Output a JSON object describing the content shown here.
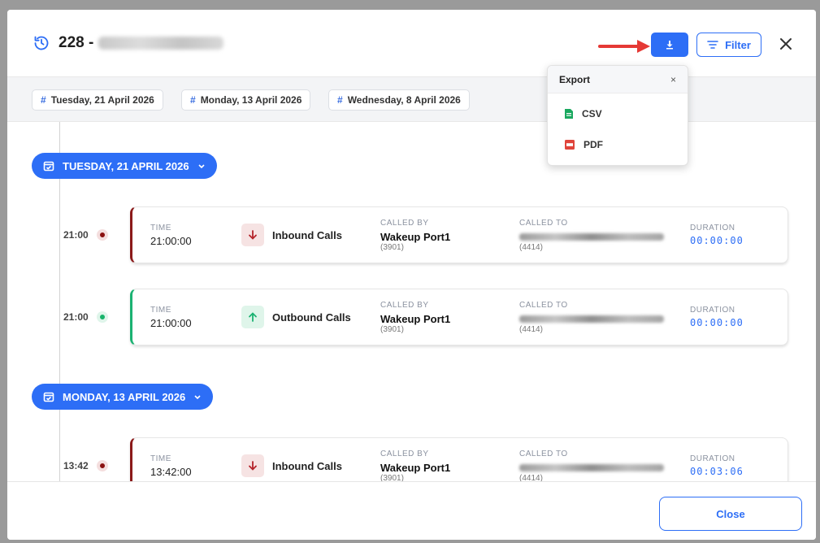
{
  "header": {
    "title_prefix": "228 -",
    "filter_label": "Filter"
  },
  "export_menu": {
    "title": "Export",
    "close": "×",
    "items": [
      {
        "label": "CSV",
        "icon": "csv-file-icon",
        "color": "#1aa85f"
      },
      {
        "label": "PDF",
        "icon": "pdf-file-icon",
        "color": "#e0443a"
      }
    ]
  },
  "date_chips": [
    {
      "hash": "#",
      "label": "Tuesday, 21 April 2026"
    },
    {
      "hash": "#",
      "label": "Monday, 13 April 2026"
    },
    {
      "hash": "#",
      "label": "Wednesday, 8 April 2026"
    }
  ],
  "groups": [
    {
      "date_label": "TUESDAY, 21 APRIL 2026",
      "calls": [
        {
          "time_short": "21:00",
          "time_label": "TIME",
          "time": "21:00:00",
          "type": "Inbound Calls",
          "called_by_label": "CALLED BY",
          "called_by": "Wakeup Port1",
          "called_by_ext": "(3901)",
          "called_to_label": "CALLED TO",
          "called_to_ext": "(4414)",
          "duration_label": "DURATION",
          "duration": "00:00:00"
        },
        {
          "time_short": "21:00",
          "time_label": "TIME",
          "time": "21:00:00",
          "type": "Outbound Calls",
          "called_by_label": "CALLED BY",
          "called_by": "Wakeup Port1",
          "called_by_ext": "(3901)",
          "called_to_label": "CALLED TO",
          "called_to_ext": "(4414)",
          "duration_label": "DURATION",
          "duration": "00:00:00"
        }
      ]
    },
    {
      "date_label": "MONDAY, 13 APRIL 2026",
      "calls": [
        {
          "time_short": "13:42",
          "time_label": "TIME",
          "time": "13:42:00",
          "type": "Inbound Calls",
          "called_by_label": "CALLED BY",
          "called_by": "Wakeup Port1",
          "called_by_ext": "(3901)",
          "called_to_label": "CALLED TO",
          "called_to_ext": "(4414)",
          "duration_label": "DURATION",
          "duration": "00:03:06"
        }
      ]
    }
  ],
  "footer": {
    "close_label": "Close"
  },
  "colors": {
    "accent": "#2d6ef6",
    "inbound": "#8b1a1a",
    "outbound": "#1bb272",
    "annotation_arrow": "#e53935"
  }
}
